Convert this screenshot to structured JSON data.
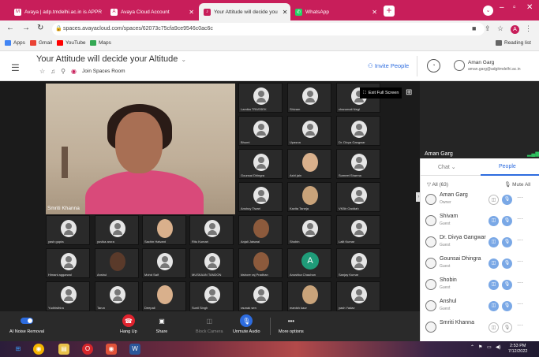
{
  "browser": {
    "tabs": [
      {
        "label": "Avaya | adp.tmdelhi.ac.in is APPR",
        "favicon": "gmail-icon"
      },
      {
        "label": "Avaya Cloud Account",
        "favicon": "avaya-icon"
      },
      {
        "label": "Your Attitude will decide you",
        "favicon": "spaces-icon"
      },
      {
        "label": "WhatsApp",
        "favicon": "whatsapp-icon"
      }
    ],
    "url": "spaces.avayacloud.com/spaces/62073c75cfa9ce9546c0ac6c",
    "bookmarks": [
      "Apps",
      "Gmail",
      "YouTube",
      "Maps"
    ],
    "reading_list": "Reading list"
  },
  "app": {
    "title": "Your Attitude will decide your Altitude",
    "join_label": "Join Spaces Room",
    "invite_label": "Invite People",
    "user_name": "Aman Garg",
    "user_email": "aman.garg@adgitmdelhi.ac.in"
  },
  "stage": {
    "speaker_name": "Smriti Khanna",
    "exit_fullscreen": "Exit Full Screen",
    "self_name": "Aman Garg",
    "tiles": [
      {
        "label": "Lamika TRASSEK",
        "kind": "avatar"
      },
      {
        "label": "Shivam",
        "kind": "avatar"
      },
      {
        "label": "charumati Negi",
        "kind": "avatar"
      },
      {
        "label": "Bhumi",
        "kind": "avatar"
      },
      {
        "label": "Upasna",
        "kind": "avatar"
      },
      {
        "label": "Dr. Divya Gangwar",
        "kind": "avatar"
      },
      {
        "label": "Gounsai Dhingra",
        "kind": "avatar"
      },
      {
        "label": "Ashi jain",
        "kind": "photo"
      },
      {
        "label": "Sumeet Sharma",
        "kind": "avatar"
      },
      {
        "label": "Anshuy Tiwari",
        "kind": "avatar"
      },
      {
        "label": "Kavita Taneja",
        "kind": "photo"
      },
      {
        "label": "VKBir Gaddah",
        "kind": "avatar"
      },
      {
        "label": "yash gupta",
        "kind": "avatar"
      },
      {
        "label": "yuvika arora",
        "kind": "avatar"
      },
      {
        "label": "Sachin Halvant",
        "kind": "photo"
      },
      {
        "label": "Ritu Kumari",
        "kind": "avatar"
      },
      {
        "label": "Anjali Jaiswal",
        "kind": "photo"
      },
      {
        "label": "Shobin",
        "kind": "avatar"
      },
      {
        "label": "Lalit Kumar",
        "kind": "avatar"
      },
      {
        "label": "Himani aggarwal",
        "kind": "avatar"
      },
      {
        "label": "Anshul",
        "kind": "photo"
      },
      {
        "label": "Mohd Saif",
        "kind": "avatar"
      },
      {
        "label": "MUSKAAN TANDON",
        "kind": "avatar"
      },
      {
        "label": "kishore raj Pradhan",
        "kind": "photo"
      },
      {
        "label": "Anushka Chauhan",
        "kind": "letter",
        "letter": "A"
      },
      {
        "label": "Sanjay Kumar",
        "kind": "avatar"
      },
      {
        "label": "Yudhisthira",
        "kind": "avatar"
      },
      {
        "label": "Tarun",
        "kind": "avatar"
      },
      {
        "label": "Deepali",
        "kind": "photo"
      },
      {
        "label": "Sunil Singh",
        "kind": "avatar"
      },
      {
        "label": "raunak sen",
        "kind": "avatar"
      },
      {
        "label": "manish kaur",
        "kind": "photo"
      },
      {
        "label": "yash Yadav",
        "kind": "avatar"
      }
    ]
  },
  "panel": {
    "tab_chat": "Chat",
    "tab_people": "People",
    "filter_label": "All (63)",
    "mute_all": "Mute All",
    "people": [
      {
        "name": "Aman Garg",
        "role": "Owner",
        "cam": false,
        "mic": true
      },
      {
        "name": "Shivam",
        "role": "Guest",
        "cam": true,
        "mic": true
      },
      {
        "name": "Dr. Divya Gangwar",
        "role": "Guest",
        "cam": true,
        "mic": true
      },
      {
        "name": "Gounsai Dhingra",
        "role": "Guest",
        "cam": true,
        "mic": true
      },
      {
        "name": "Shobin",
        "role": "Guest",
        "cam": true,
        "mic": true
      },
      {
        "name": "Anshul",
        "role": "Guest",
        "cam": true,
        "mic": true
      },
      {
        "name": "Smriti Khanna",
        "role": "",
        "cam": false,
        "mic": false
      }
    ]
  },
  "toolbar": {
    "noise": "AI Noise Removal",
    "hangup": "Hang Up",
    "share": "Share",
    "block_camera": "Block Camera",
    "unmute": "Unmute Audio",
    "more": "More options"
  },
  "taskbar": {
    "time": "2:53 PM",
    "date": "7/12/2022"
  },
  "colors": {
    "chrome_tab": "#c81e5a",
    "accent": "#2d6cdf",
    "stage_bg": "#1b1b1b",
    "hangup": "#e0232e"
  }
}
